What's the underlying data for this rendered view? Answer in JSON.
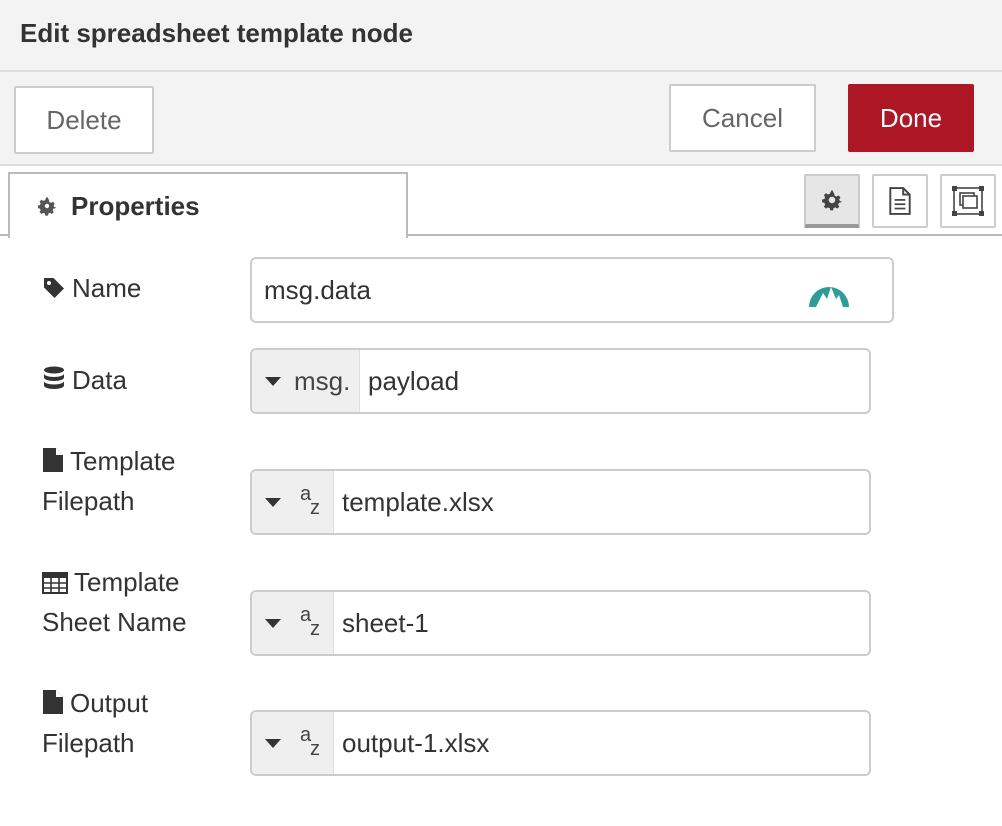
{
  "dialog": {
    "title": "Edit spreadsheet template node"
  },
  "toolbar": {
    "delete_label": "Delete",
    "cancel_label": "Cancel",
    "done_label": "Done"
  },
  "tabs": [
    {
      "label": "Properties",
      "icon": "gear-icon"
    }
  ],
  "tab_buttons": [
    {
      "icon": "gear-icon",
      "active": true
    },
    {
      "icon": "document-icon",
      "active": false
    },
    {
      "icon": "appearance-icon",
      "active": false
    }
  ],
  "form": {
    "name": {
      "label": "Name",
      "icon": "tag-icon",
      "value": "msg.data",
      "badge_icon": "mountain-badge-icon"
    },
    "data": {
      "label": "Data",
      "icon": "database-icon",
      "type_prefix": "msg.",
      "value": "payload"
    },
    "template_filepath": {
      "label_line1": "Template",
      "label_line2": "Filepath",
      "icon": "file-icon",
      "type_icon": "string-type-icon",
      "type_a": "a",
      "type_z": "z",
      "value": "template.xlsx"
    },
    "sheet_name": {
      "label_line1": "Template",
      "label_line2": "Sheet Name",
      "icon": "table-icon",
      "type_icon": "string-type-icon",
      "type_a": "a",
      "type_z": "z",
      "value": "sheet-1"
    },
    "output_filepath": {
      "label_line1": "Output",
      "label_line2": "Filepath",
      "icon": "file-icon",
      "type_icon": "string-type-icon",
      "type_a": "a",
      "type_z": "z",
      "value": "output-1.xlsx"
    }
  },
  "colors": {
    "done_button": "#ad1625",
    "badge": "#2e9c97",
    "header_bg": "#f3f3f3"
  }
}
